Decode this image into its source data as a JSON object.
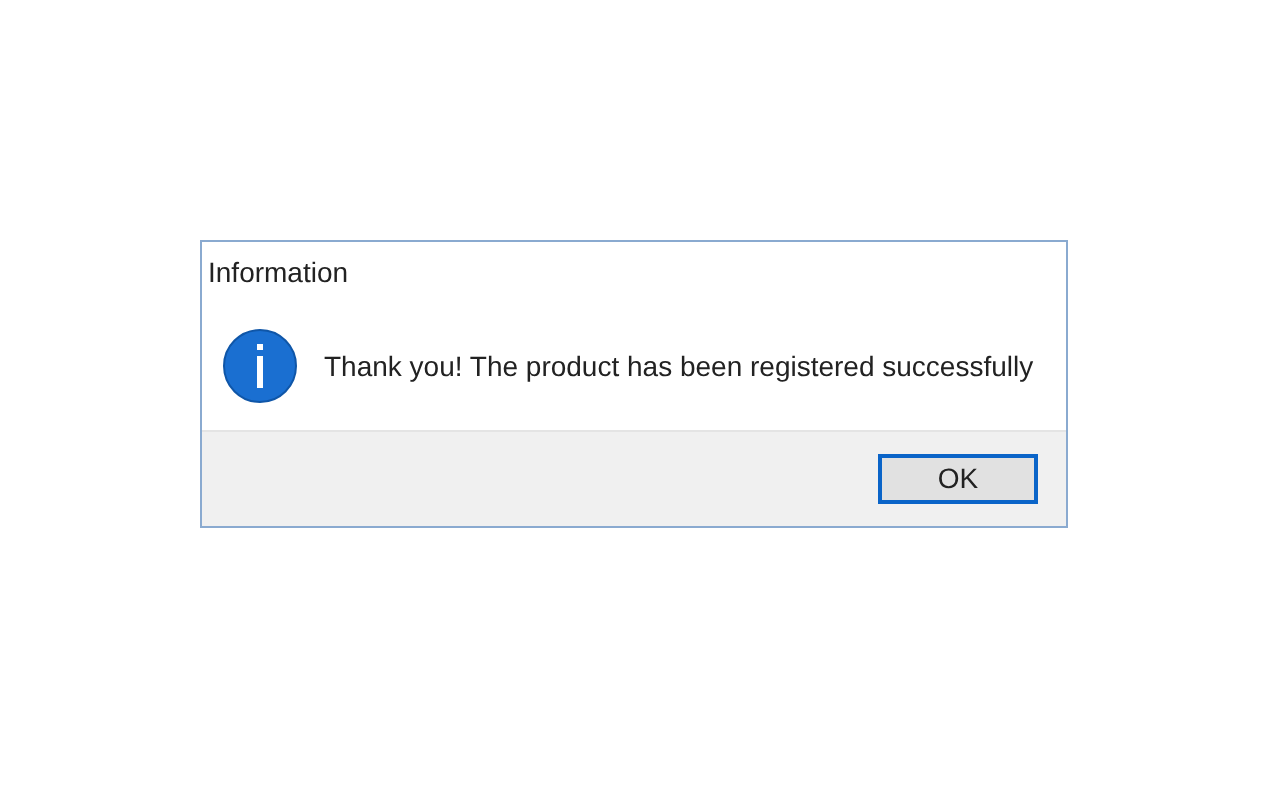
{
  "window": {
    "title": "Information"
  },
  "message": {
    "kind": "information",
    "text": "Thank you! The product has been registered successfully"
  },
  "buttons": [
    {
      "label": "OK",
      "selected": true
    }
  ]
}
